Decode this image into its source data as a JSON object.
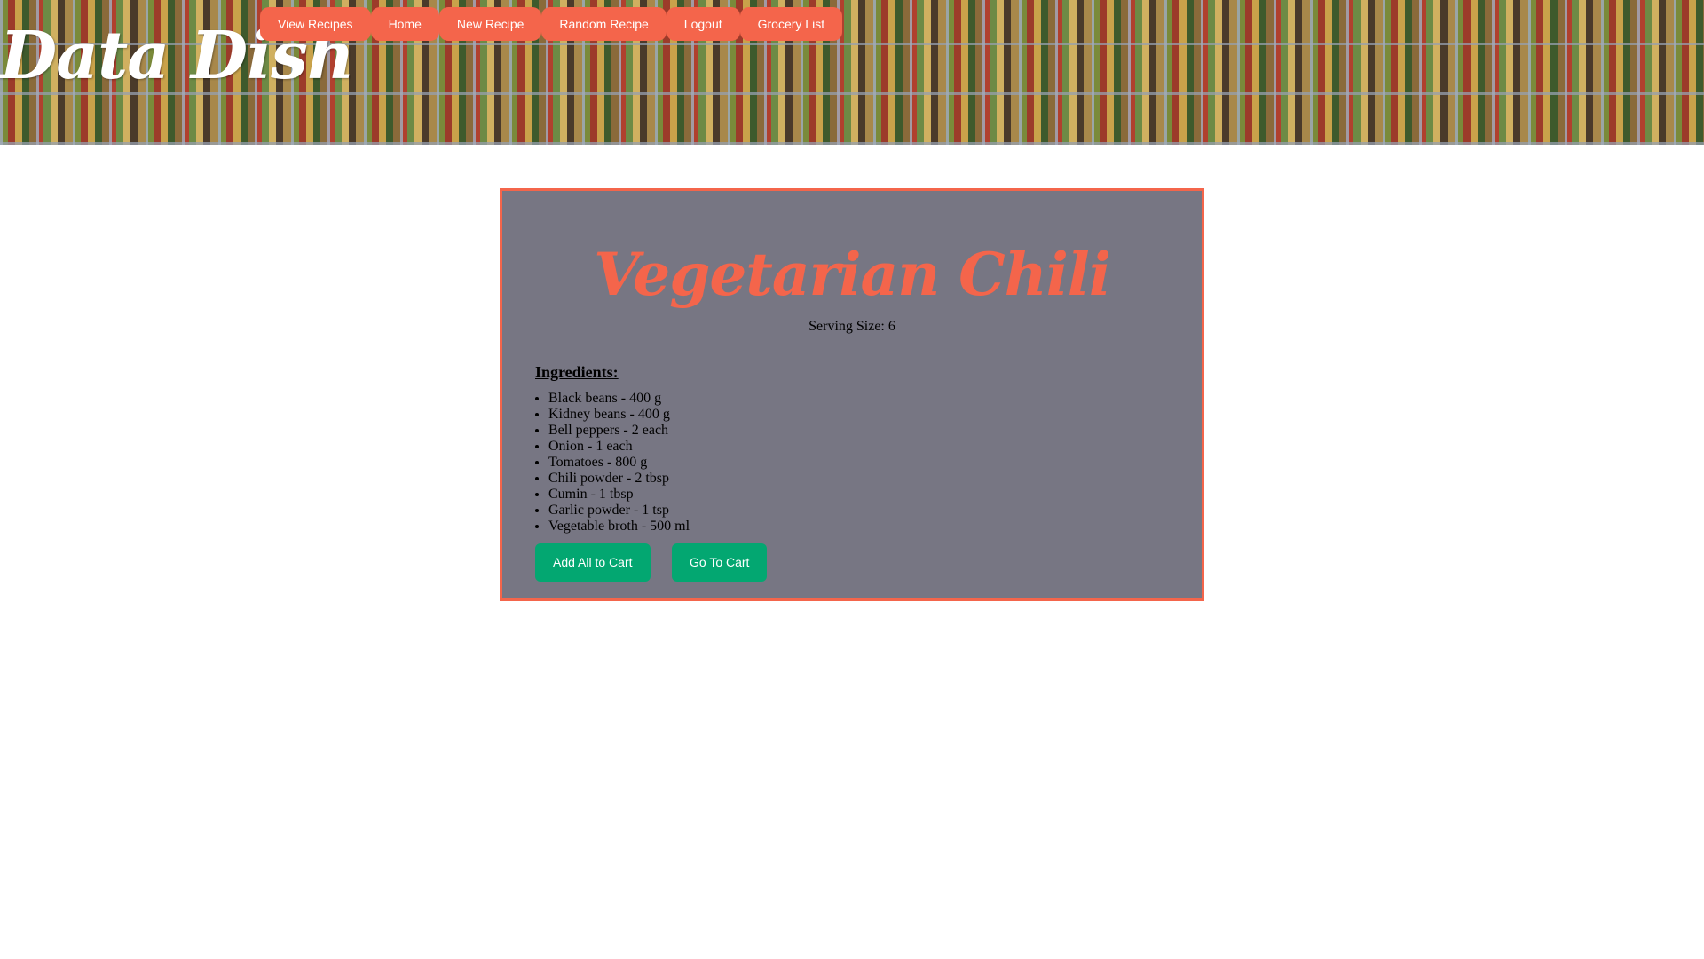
{
  "brand": {
    "name": "Data Dish",
    "accent_color": "#f4654b",
    "success_color": "#03a771"
  },
  "nav": {
    "items": [
      {
        "label": "View Recipes"
      },
      {
        "label": "Home"
      },
      {
        "label": "New Recipe"
      },
      {
        "label": "Random Recipe"
      },
      {
        "label": "Logout"
      },
      {
        "label": "Grocery List"
      }
    ]
  },
  "recipe": {
    "title": "Vegetarian Chili",
    "serving_size": "Serving Size: 6",
    "ingredients_heading": "Ingredients:",
    "ingredients": [
      "Black beans - 400 g",
      "Kidney beans - 400 g",
      "Bell peppers - 2 each",
      "Onion - 1 each",
      "Tomatoes - 800 g",
      "Chili powder - 2 tbsp",
      "Cumin - 1 tbsp",
      "Garlic powder - 1 tsp",
      "Vegetable broth - 500 ml"
    ]
  },
  "actions": {
    "add_all_label": "Add All to Cart",
    "go_to_cart_label": "Go To Cart"
  }
}
